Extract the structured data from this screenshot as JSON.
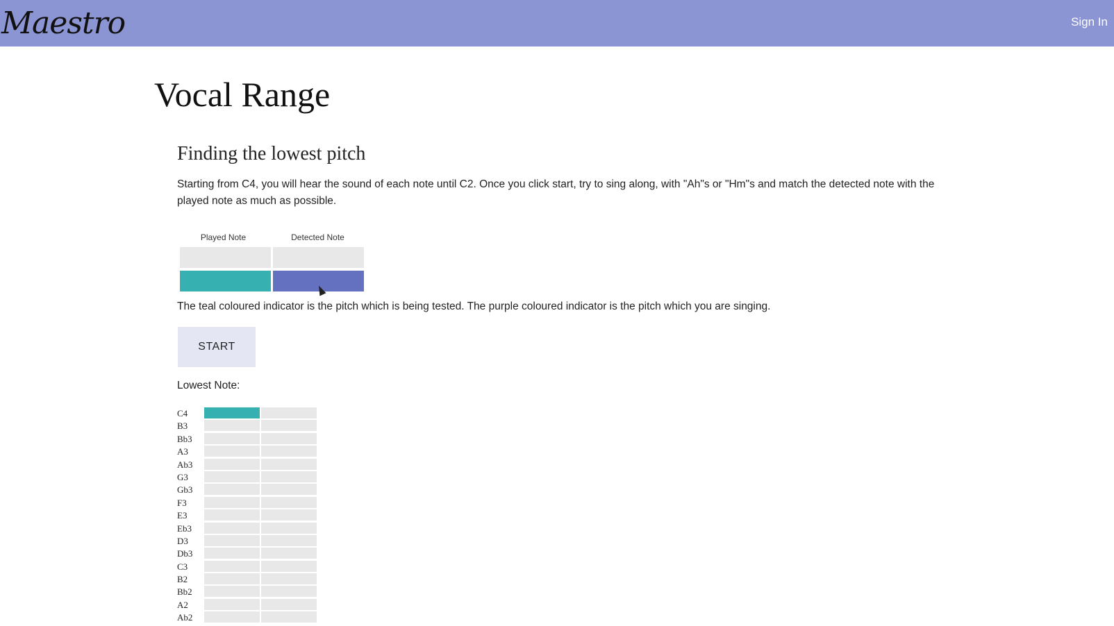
{
  "header": {
    "logo_text": "Maestro",
    "signin_label": "Sign In",
    "background_color": "#8c95d4"
  },
  "page": {
    "title": "Vocal Range",
    "section_title": "Finding the lowest pitch",
    "description": "Starting from C4, you will hear the sound of each note until C2. Once you click start, try to sing along, with \"Ah\"s or \"Hm\"s and match the detected note with the played note as much as possible.",
    "indicator": {
      "played_label": "Played Note",
      "detected_label": "Detected Note",
      "played_color": "#36b0b0",
      "detected_color": "#6470c0"
    },
    "indicator_explanation": "The teal coloured indicator is the pitch which is being tested. The purple coloured indicator is the pitch which you are singing.",
    "start_label": "START",
    "lowest_note_label": "Lowest Note:",
    "notes": [
      "C4",
      "B3",
      "Bb3",
      "A3",
      "Ab3",
      "G3",
      "Gb3",
      "F3",
      "E3",
      "Eb3",
      "D3",
      "Db3",
      "C3",
      "B2",
      "Bb2",
      "A2",
      "Ab2"
    ],
    "active_note": "C4"
  }
}
